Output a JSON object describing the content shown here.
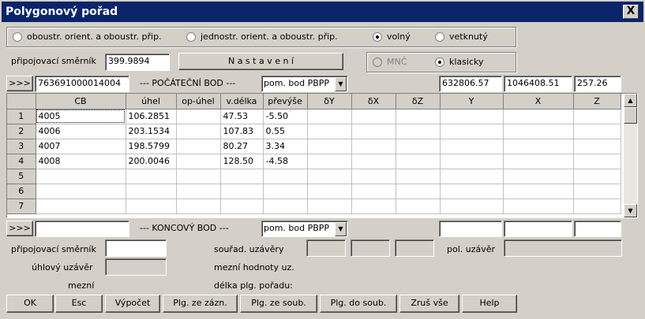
{
  "window": {
    "title": "Polygonový pořad",
    "close_glyph": "X"
  },
  "orientation": {
    "options": [
      {
        "label": "oboustr. orient. a oboustr. přip.",
        "checked": false
      },
      {
        "label": "jednostr. orient. a oboustr. přip.",
        "checked": false
      },
      {
        "label": "volný",
        "checked": true
      },
      {
        "label": "vetknutý",
        "checked": false
      }
    ]
  },
  "connect": {
    "label": "připojovací směrník",
    "value": "399.9894"
  },
  "settings_button": "N a s t a v e n í",
  "method": {
    "options": [
      {
        "label": "MNČ",
        "checked": false,
        "disabled": true
      },
      {
        "label": "klasicky",
        "checked": true,
        "disabled": false
      }
    ]
  },
  "start": {
    "nav": ">>>",
    "cb": "763691000014004",
    "label": "--- POČÁTEČNÍ BOD ---",
    "combo": "pom. bod PBPP",
    "y": "632806.57",
    "x": "1046408.51",
    "z": "257.26"
  },
  "table": {
    "columns": [
      "CB",
      "úhel",
      "op-úhel",
      "v.délka",
      "převýše",
      "δY",
      "δX",
      "δZ",
      "Y",
      "X",
      "Z"
    ],
    "rows": [
      {
        "n": "1",
        "cells": [
          "4005",
          "106.2851",
          "",
          "47.53",
          "-5.50",
          "",
          "",
          "",
          "",
          "",
          ""
        ]
      },
      {
        "n": "2",
        "cells": [
          "4006",
          "203.1534",
          "",
          "107.83",
          "0.55",
          "",
          "",
          "",
          "",
          "",
          ""
        ]
      },
      {
        "n": "3",
        "cells": [
          "4007",
          "198.5799",
          "",
          "80.27",
          "3.34",
          "",
          "",
          "",
          "",
          "",
          ""
        ]
      },
      {
        "n": "4",
        "cells": [
          "4008",
          "200.0046",
          "",
          "128.50",
          "-4.58",
          "",
          "",
          "",
          "",
          "",
          ""
        ]
      },
      {
        "n": "5",
        "cells": [
          "",
          "",
          "",
          "",
          "",
          "",
          "",
          "",
          "",
          "",
          ""
        ]
      },
      {
        "n": "6",
        "cells": [
          "",
          "",
          "",
          "",
          "",
          "",
          "",
          "",
          "",
          "",
          ""
        ]
      },
      {
        "n": "7",
        "cells": [
          "",
          "",
          "",
          "",
          "",
          "",
          "",
          "",
          "",
          "",
          ""
        ]
      }
    ]
  },
  "end": {
    "nav": ">>>",
    "cb": "",
    "label": "--- KONCOVÝ BOD ---",
    "combo": "pom. bod PBPP",
    "y": "",
    "x": "",
    "z": ""
  },
  "results": {
    "connect_label": "připojovací směrník",
    "connect_value": "",
    "angle_label": "úhlový uzávěr",
    "angle_value": "",
    "limit_label": "mezní",
    "coord_label": "souřad. uzávěry",
    "pol_label": "pol. uzávěr",
    "limits_label": "mezní hodnoty uz.",
    "length_label": "délka plg. pořadu:"
  },
  "buttons": {
    "ok": "OK",
    "esc": "Esc",
    "calc": "Výpočet",
    "from_rec": "Plg. ze zázn.",
    "from_file": "Plg. ze soub.",
    "to_file": "Plg. do soub.",
    "clear": "Zruš vše",
    "help": "Help"
  },
  "icons": {
    "scroll_up": "▲",
    "scroll_down": "▼",
    "combo_arrow": "▼"
  }
}
